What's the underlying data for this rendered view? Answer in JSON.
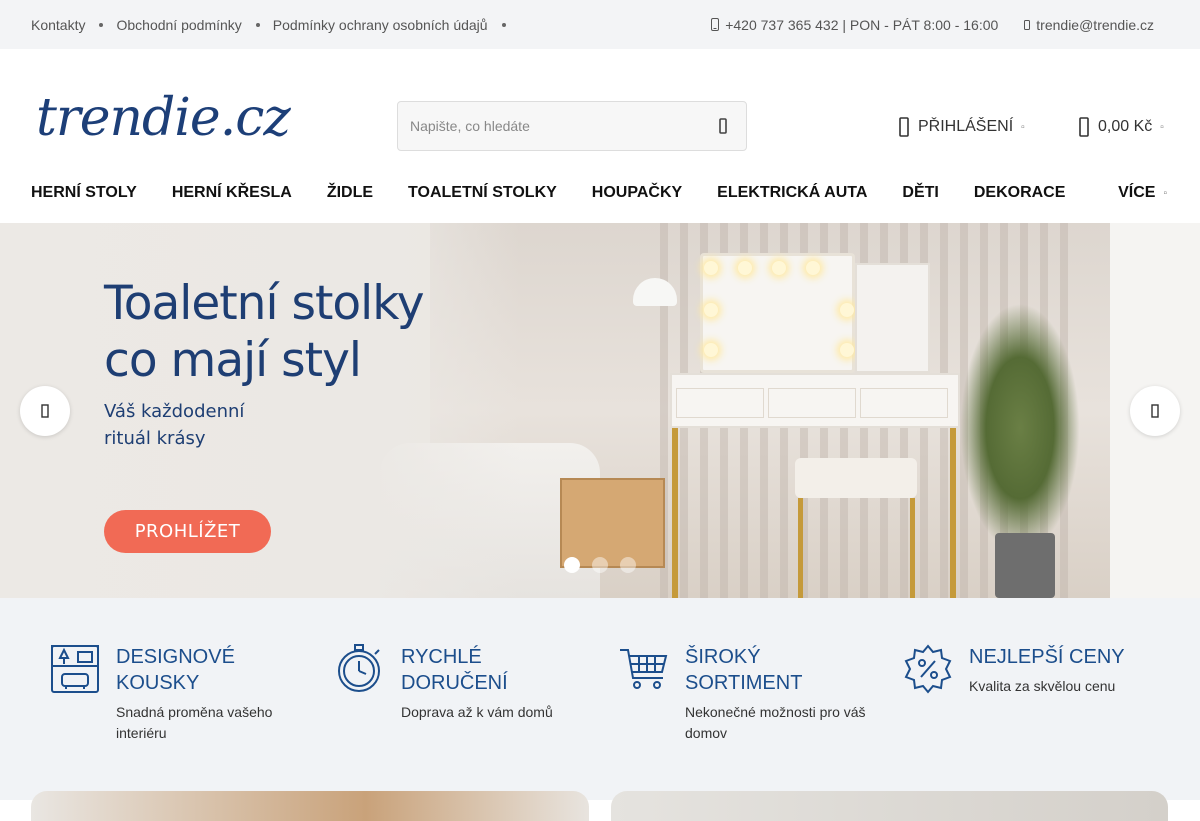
{
  "topbar": {
    "links": [
      "Kontakty",
      "Obchodní podmínky",
      "Podmínky ochrany osobních údajů"
    ],
    "phone": "+420 737 365 432 | PON - PÁT 8:00 - 16:00",
    "email": "trendie@trendie.cz"
  },
  "header": {
    "logo": "trendie.cz",
    "search_placeholder": "Napište, co hledáte",
    "login_label": "PŘIHLÁŠENÍ",
    "cart_total": "0,00 Kč"
  },
  "nav": {
    "items": [
      "HERNÍ STOLY",
      "HERNÍ KŘESLA",
      "ŽIDLE",
      "TOALETNÍ STOLKY",
      "HOUPAČKY",
      "ELEKTRICKÁ AUTA",
      "DĚTI",
      "DEKORACE"
    ],
    "more_label": "VÍCE"
  },
  "hero": {
    "title_line1": "Toaletní stolky",
    "title_line2": "co mají styl",
    "subtitle_line1": "Váš každodenní",
    "subtitle_line2": "rituál krásy",
    "cta_label": "PROHLÍŽET",
    "active_slide": 1,
    "slide_count": 3
  },
  "benefits": [
    {
      "icon": "design-furniture-icon",
      "title_line1": "DESIGNOVÉ",
      "title_line2": "KOUSKY",
      "desc_line1": "Snadná proměna vašeho",
      "desc_line2": "interiéru"
    },
    {
      "icon": "stopwatch-icon",
      "title_line1": "RYCHLÉ",
      "title_line2": "DORUČENÍ",
      "desc_line1": "Doprava až k vám domů",
      "desc_line2": ""
    },
    {
      "icon": "shopping-cart-icon",
      "title_line1": "ŠIROKÝ",
      "title_line2": "SORTIMENT",
      "desc_line1": "Nekonečné možnosti pro váš",
      "desc_line2": "domov"
    },
    {
      "icon": "discount-badge-icon",
      "title_line1": "NEJLEPŠÍ CENY",
      "title_line2": "",
      "desc_line1": "Kvalita za skvělou cenu",
      "desc_line2": ""
    }
  ],
  "colors": {
    "brand_blue": "#1d3f78",
    "accent_coral": "#f16a55",
    "icon_blue": "#1c4e8c"
  }
}
